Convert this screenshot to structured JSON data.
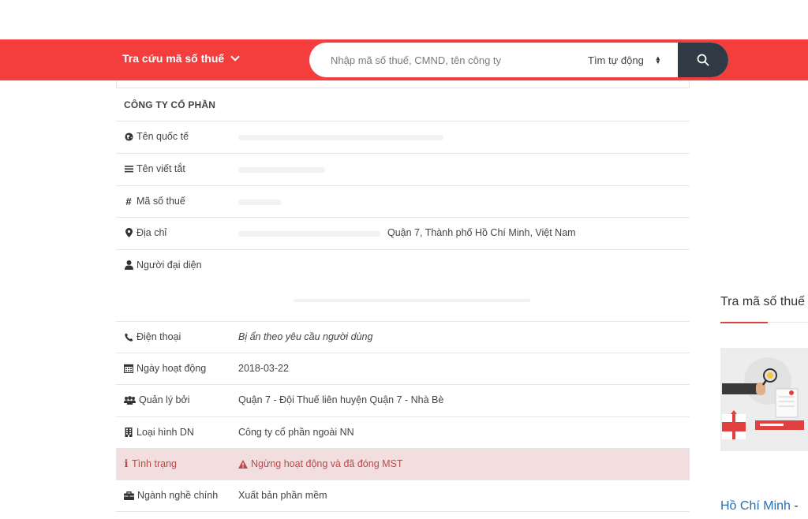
{
  "header": {
    "brand_label": "Tra cứu mã số thuế",
    "search_placeholder": "Nhập mã số thuế, CMND, tên công ty",
    "mode_label": "Tìm tự động",
    "colors": {
      "bar": "#f43d3d",
      "search_button": "#2f3a45"
    }
  },
  "company": {
    "type_label": "CÔNG TY CỔ PHẦN",
    "fields": [
      {
        "icon": "globe-icon",
        "label": "Tên quốc tế",
        "value": ""
      },
      {
        "icon": "list-icon",
        "label": "Tên viết tắt",
        "value": ""
      },
      {
        "icon": "hash-icon",
        "label": "Mã số thuế",
        "value": ""
      },
      {
        "icon": "map-pin-icon",
        "label": "Địa chỉ",
        "value": "Quận 7, Thành phố Hồ Chí Minh, Việt Nam"
      },
      {
        "icon": "user-icon",
        "label": "Người đại diện",
        "value": ""
      },
      {
        "icon": "phone-icon",
        "label": "Điện thoại",
        "value": "Bị ẩn theo yêu cầu người dùng"
      },
      {
        "icon": "calendar-icon",
        "label": "Ngày hoạt động",
        "value": "2018-03-22"
      },
      {
        "icon": "users-icon",
        "label": "Quản lý bởi",
        "value": "Quận 7 - Đội Thuế liên huyện Quận 7 - Nhà Bè"
      },
      {
        "icon": "building-icon",
        "label": "Loại hình DN",
        "value": "Công ty cổ phần ngoài NN"
      },
      {
        "icon": "info-icon",
        "label": "Tình trạng",
        "value": "Ngừng hoạt động và đã đóng MST"
      },
      {
        "icon": "briefcase-icon",
        "label": "Ngành nghề chính",
        "value": "Xuất bản phần mềm"
      }
    ],
    "alert_color": "#f2dede"
  },
  "sidebar": {
    "title": "Tra mã số thuế",
    "link_city": "Hồ Chí Minh",
    "link_sep": " - "
  }
}
